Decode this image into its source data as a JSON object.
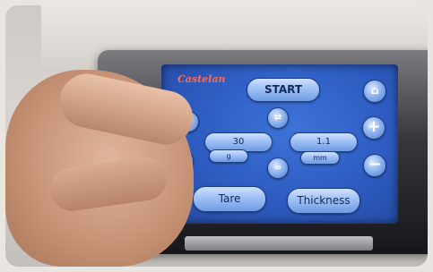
{
  "screen": {
    "brand": "Castelan",
    "start_label": "START",
    "tare_label": "Tare",
    "thickness_label": "Thickness",
    "left_value": "30",
    "left_unit": "g",
    "right_value": "1.1",
    "right_unit": "mm",
    "plus": "+",
    "minus": "−",
    "home_icon": "⌂"
  }
}
